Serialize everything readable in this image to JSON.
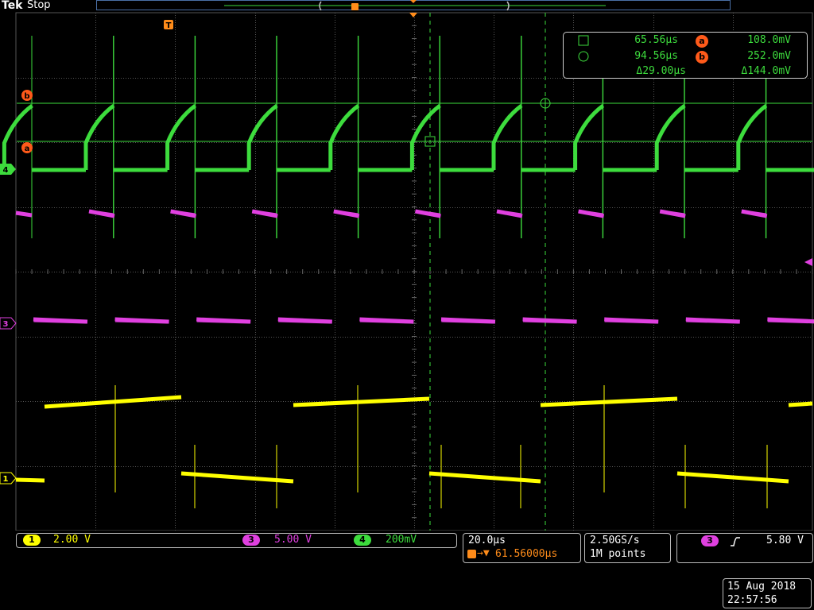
{
  "header": {
    "brand": "Tek",
    "run_state": "Stop"
  },
  "cursor_readout": {
    "cursor1_time": "65.56µs",
    "cursor2_time": "94.56µs",
    "delta_time": "Δ29.00µs",
    "cursor_a_level": "108.0mV",
    "cursor_b_level": "252.0mV",
    "delta_level": "Δ144.0mV",
    "cursor_a_label": "a",
    "cursor_b_label": "b"
  },
  "channels": [
    {
      "id": "1",
      "scale": "2.00 V",
      "color": "#ffff00"
    },
    {
      "id": "3",
      "scale": "5.00 V",
      "color": "#e040e0"
    },
    {
      "id": "4",
      "scale": "200mV",
      "color": "#3ddc3d"
    }
  ],
  "horizontal": {
    "time_div": "20.0µs",
    "trigger_pos": "61.56000µs",
    "trigger_marker": "T"
  },
  "acquisition": {
    "sample_rate": "2.50GS/s",
    "record_length": "1M points"
  },
  "trigger": {
    "source": "3",
    "level": "5.80 V"
  },
  "datetime": {
    "date": "15 Aug 2018",
    "time": "22:57:56"
  },
  "colors": {
    "ch1": "#ffff00",
    "ch3": "#e040e0",
    "ch4": "#3ddc3d",
    "cursor": "#3ddc3d",
    "accent": "#ff8c1a",
    "grid": "#555555"
  }
}
